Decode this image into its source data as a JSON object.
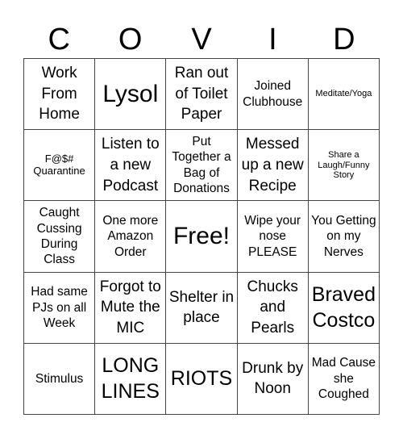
{
  "header": [
    "C",
    "O",
    "V",
    "I",
    "D"
  ],
  "cells": [
    {
      "text": "Work From Home",
      "size": "s-lg"
    },
    {
      "text": "Lysol",
      "size": "s-xxl"
    },
    {
      "text": "Ran out of Toilet Paper",
      "size": "s-lg"
    },
    {
      "text": "Joined Clubhouse",
      "size": "s-md"
    },
    {
      "text": "Meditate/Yoga",
      "size": "s-xs"
    },
    {
      "text": "F@$# Quarantine",
      "size": "s-sm"
    },
    {
      "text": "Listen to a new Podcast",
      "size": "s-lg"
    },
    {
      "text": "Put Together a Bag of Donations",
      "size": "s-md"
    },
    {
      "text": "Messed up a new Recipe",
      "size": "s-lg"
    },
    {
      "text": "Share a Laugh/Funny Story",
      "size": "s-xs"
    },
    {
      "text": "Caught Cussing During Class",
      "size": "s-md"
    },
    {
      "text": "One more Amazon Order",
      "size": "s-md"
    },
    {
      "text": "Free!",
      "size": "s-xxl"
    },
    {
      "text": "Wipe your nose PLEASE",
      "size": "s-md"
    },
    {
      "text": "You Getting on my Nerves",
      "size": "s-md"
    },
    {
      "text": "Had same PJs on all Week",
      "size": "s-md"
    },
    {
      "text": "Forgot to Mute the MIC",
      "size": "s-lg"
    },
    {
      "text": "Shelter in place",
      "size": "s-lg"
    },
    {
      "text": "Chucks and Pearls",
      "size": "s-lg"
    },
    {
      "text": "Braved Costco",
      "size": "s-xl"
    },
    {
      "text": "Stimulus",
      "size": "s-md"
    },
    {
      "text": "LONG LINES",
      "size": "s-xl"
    },
    {
      "text": "RIOTS",
      "size": "s-xl"
    },
    {
      "text": "Drunk by Noon",
      "size": "s-lg"
    },
    {
      "text": "Mad Cause she Coughed",
      "size": "s-md"
    }
  ]
}
